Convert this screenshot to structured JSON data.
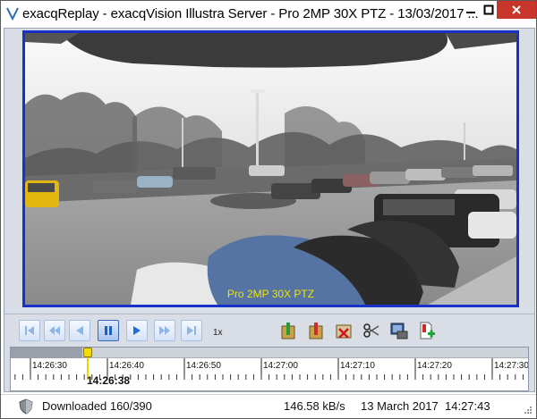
{
  "window": {
    "title": "exacqReplay - exacqVision Illustra Server - Pro 2MP 30X PTZ - 13/03/2017 ..."
  },
  "video": {
    "camera_label": "Pro 2MP 30X PTZ"
  },
  "playback": {
    "speed": "1x"
  },
  "timeline": {
    "ticks": [
      "14:26:30",
      "14:26:40",
      "14:26:50",
      "14:27:00",
      "14:27:10",
      "14:27:20",
      "14:27:30"
    ],
    "cursor_time": "14:26:38"
  },
  "status": {
    "downloaded": "Downloaded 160/390",
    "rate": "146.58 kB/s",
    "date": "13 March 2017",
    "time": "14:27:43"
  },
  "colors": {
    "video_border": "#1832c8",
    "camera_label": "#f0e400",
    "close_button": "#c7352b",
    "cursor": "#f0d000"
  }
}
